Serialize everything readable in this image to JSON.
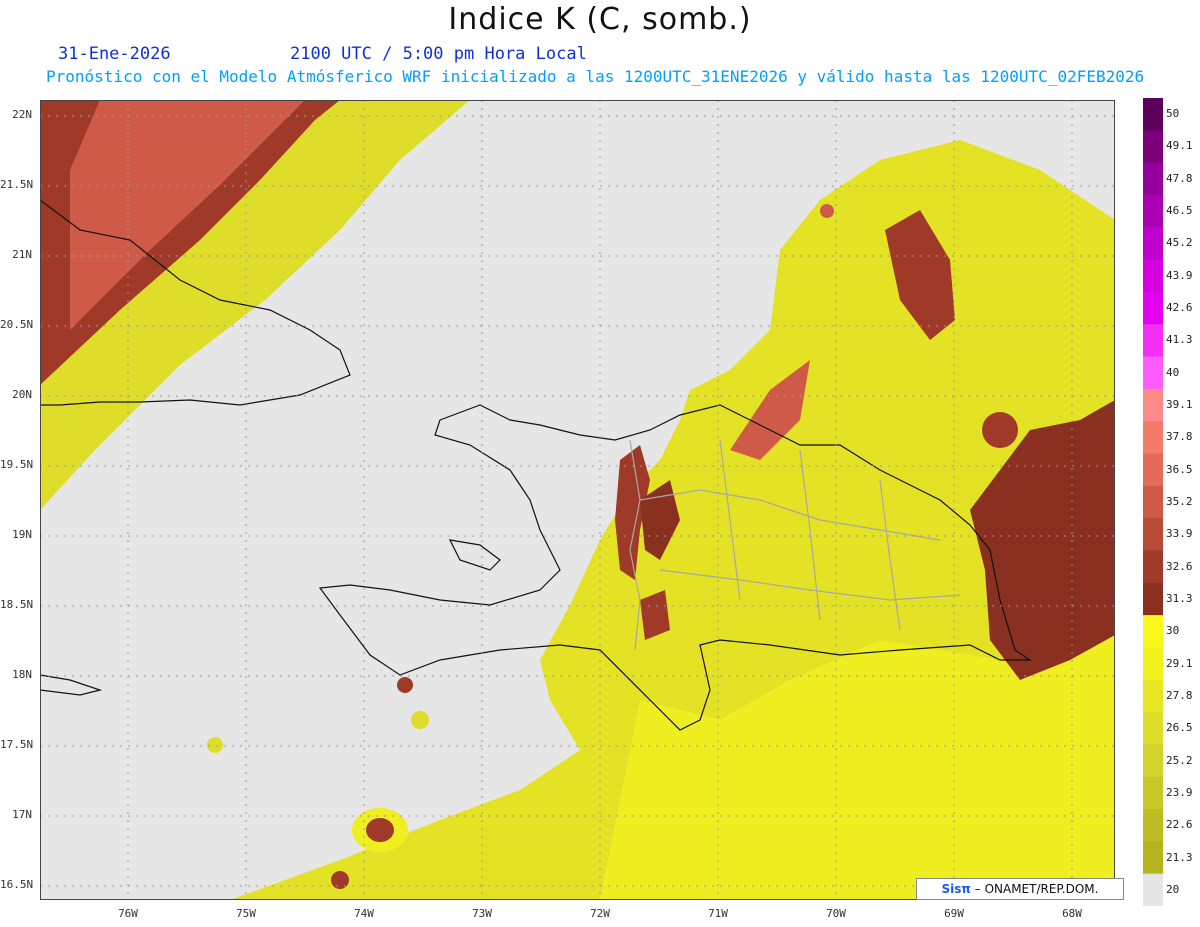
{
  "title": "Indice K (C, somb.)",
  "date": "31-Ene-2026",
  "time_label": "2100 UTC / 5:00 pm Hora Local",
  "forecast_label": "Pronóstico con el Modelo Atmósferico WRF inicializado a las 1200UTC_31ENE2026 y válido hasta las  1200UTC_02FEB2026",
  "lat_labels": [
    "22N",
    "21.5N",
    "21N",
    "20.5N",
    "20N",
    "19.5N",
    "19N",
    "18.5N",
    "18N",
    "17.5N",
    "17N",
    "16.5N"
  ],
  "lon_labels": [
    "76W",
    "75W",
    "74W",
    "73W",
    "72W",
    "71W",
    "70W",
    "69W",
    "68W"
  ],
  "legend": {
    "levels": [
      "50",
      "49.1",
      "47.8",
      "46.5",
      "45.2",
      "43.9",
      "42.6",
      "41.3",
      "40",
      "39.1",
      "37.8",
      "36.5",
      "35.2",
      "33.9",
      "32.6",
      "31.3",
      "30",
      "29.1",
      "27.8",
      "26.5",
      "25.2",
      "23.9",
      "22.6",
      "21.3",
      "20"
    ],
    "colors": [
      "#5c005c",
      "#7a007a",
      "#93009c",
      "#aa00b4",
      "#c000cc",
      "#d400e0",
      "#e600f0",
      "#f52ef5",
      "#ff5cff",
      "#ff8a8a",
      "#f47a6a",
      "#e56a5a",
      "#d05a48",
      "#b84a38",
      "#a03a28",
      "#8a3020",
      "#f8f81c",
      "#f2f21e",
      "#e8e622",
      "#dede2a",
      "#d2d22a",
      "#c8c828",
      "#bebe22",
      "#b4b41c",
      "#e6e6e6"
    ]
  },
  "credit": {
    "brand": "Sisπ",
    "text": "– ONAMET/REP.DOM."
  }
}
